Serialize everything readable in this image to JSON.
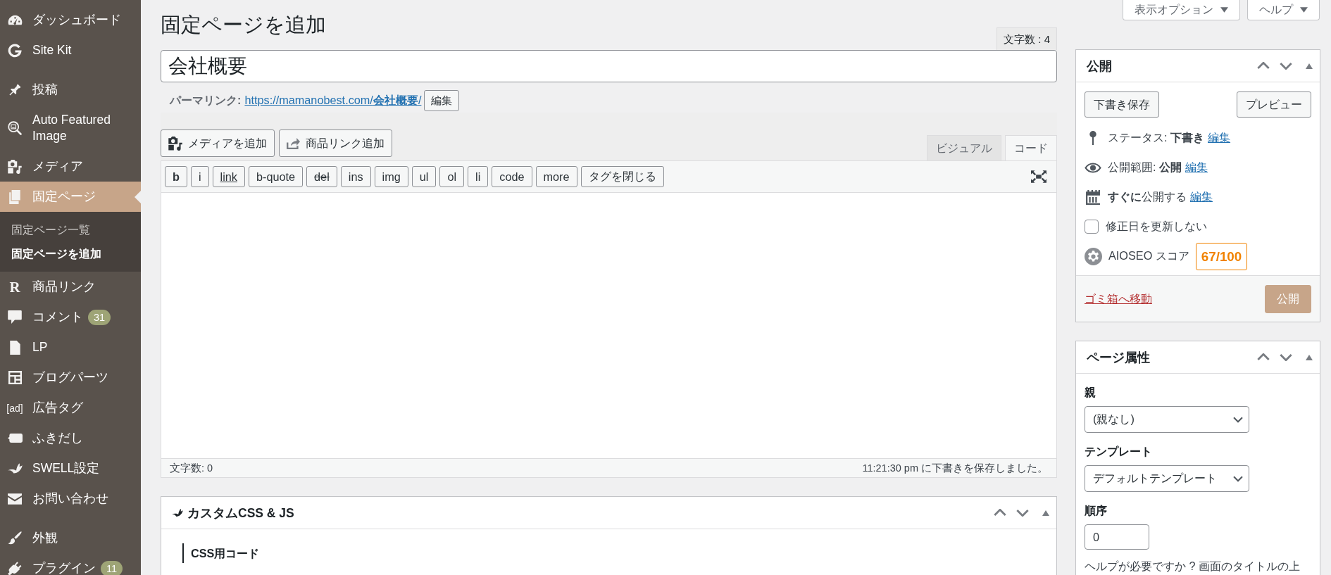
{
  "sidebar": {
    "groups": [
      {
        "items": [
          {
            "label": "ダッシュボード",
            "selected": false
          },
          {
            "label": "Site Kit",
            "selected": false
          }
        ]
      },
      {
        "items": [
          {
            "label": "投稿",
            "selected": false
          },
          {
            "label": "Auto Featured Image",
            "selected": false
          },
          {
            "label": "メディア",
            "selected": false
          },
          {
            "label": "固定ページ",
            "selected": true,
            "children": [
              {
                "label": "固定ページ一覧",
                "selected": false
              },
              {
                "label": "固定ページを追加",
                "selected": true
              }
            ]
          },
          {
            "label": "商品リンク",
            "selected": false,
            "icon_text": "R"
          },
          {
            "label": "コメント",
            "selected": false,
            "badge": "31"
          },
          {
            "label": "LP",
            "selected": false
          },
          {
            "label": "ブログパーツ",
            "selected": false
          },
          {
            "label": "広告タグ",
            "selected": false,
            "icon_text": "[ad]"
          },
          {
            "label": "ふきだし",
            "selected": false
          },
          {
            "label": "SWELL設定",
            "selected": false
          },
          {
            "label": "お問い合わせ",
            "selected": false
          }
        ]
      },
      {
        "items": [
          {
            "label": "外観",
            "selected": false
          },
          {
            "label": "プラグイン",
            "selected": false,
            "badge": "11"
          }
        ]
      }
    ]
  },
  "screen_meta": [
    {
      "label": "表示オプション"
    },
    {
      "label": "ヘルプ"
    }
  ],
  "heading": "固定ページを追加",
  "char_count": "文字数 : 4",
  "title_field": {
    "value": "会社概要"
  },
  "permalink": {
    "label": "パーマリンク:",
    "url": "https://mamanobest.com/**会社概要**/",
    "button": "編集"
  },
  "editor": {
    "media_buttons": [
      {
        "label": "メディアを追加"
      },
      {
        "label": "商品リンク追加"
      }
    ],
    "tabs": [
      {
        "label": "ビジュアル",
        "selected": false
      },
      {
        "label": "コード",
        "selected": true
      }
    ],
    "quicktags": [
      {
        "label": "b",
        "kind": "bold"
      },
      {
        "label": "i",
        "kind": "plain"
      },
      {
        "label": "link",
        "kind": "underline"
      },
      {
        "label": "b-quote",
        "kind": "plain"
      },
      {
        "label": "del",
        "kind": "strike"
      },
      {
        "label": "ins",
        "kind": "plain"
      },
      {
        "label": "img",
        "kind": "plain"
      },
      {
        "label": "ul",
        "kind": "plain"
      },
      {
        "label": "ol",
        "kind": "plain"
      },
      {
        "label": "li",
        "kind": "plain"
      },
      {
        "label": "code",
        "kind": "plain"
      },
      {
        "label": "more",
        "kind": "plain"
      },
      {
        "label": "タグを閉じる",
        "kind": "plain"
      }
    ],
    "word_count": "文字数: 0",
    "autosave": "11:21:30 pm に下書きを保存しました。"
  },
  "custom_code_box": {
    "title": "カスタムCSS & JS",
    "section": "CSS用コード"
  },
  "publish_box": {
    "title": "公開",
    "save_draft": "下書き保存",
    "preview": "プレビュー",
    "rows": [
      {
        "kind": "status",
        "text": "ステータス: **下書き**",
        "link": "編集"
      },
      {
        "kind": "visibility",
        "text": "公開範囲: **公開**",
        "link": "編集"
      },
      {
        "kind": "schedule",
        "text": "**すぐに**公開する",
        "link": "編集"
      }
    ],
    "checkbox": {
      "label": "修正日を更新しない",
      "checked": false
    },
    "aioseo": {
      "label": "AIOSEO スコア",
      "score": "67/100"
    },
    "trash": "ゴミ箱へ移動",
    "publish": "公開"
  },
  "page_attributes": {
    "title": "ページ属性",
    "parent": {
      "label": "親",
      "value": "(親なし)"
    },
    "template": {
      "label": "テンプレート",
      "value": "デフォルトテンプレート"
    },
    "order": {
      "label": "順序",
      "value": "0"
    },
    "help": "ヘルプが必要ですか ? 画面のタイトルの上"
  }
}
